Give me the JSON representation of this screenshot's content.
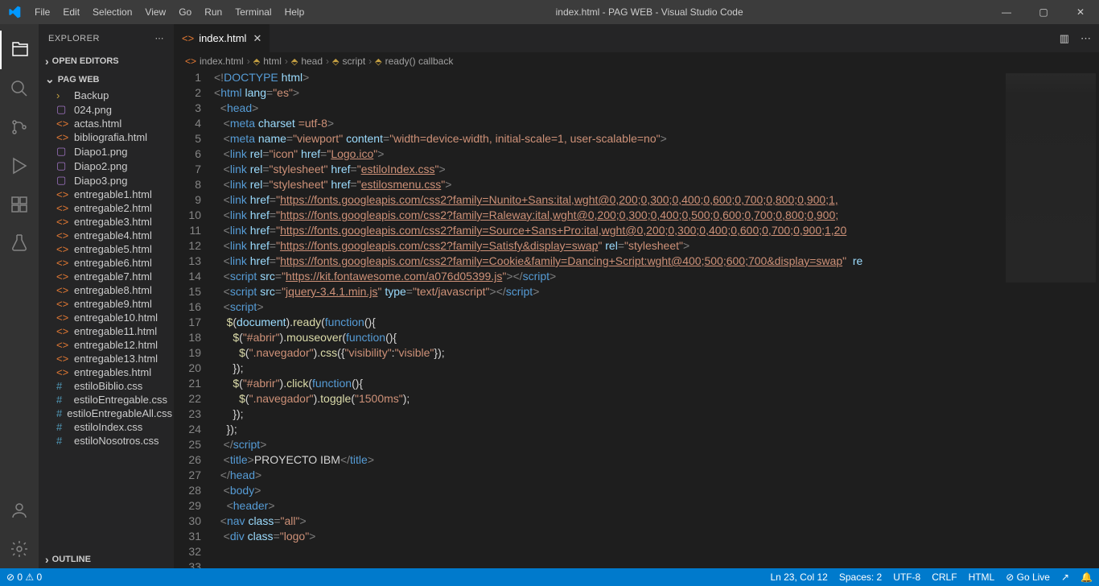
{
  "titlebar": {
    "menus": [
      "File",
      "Edit",
      "Selection",
      "View",
      "Go",
      "Run",
      "Terminal",
      "Help"
    ],
    "title": "index.html - PAG WEB - Visual Studio Code"
  },
  "activitybar": {
    "icons": [
      "files-icon",
      "search-icon",
      "source-control-icon",
      "run-debug-icon",
      "extensions-icon",
      "testing-icon"
    ],
    "bottom": [
      "account-icon",
      "gear-icon"
    ]
  },
  "sidebar": {
    "title": "EXPLORER",
    "sections": {
      "open_editors": "OPEN EDITORS",
      "folder": "PAG WEB",
      "outline": "OUTLINE"
    },
    "files": [
      {
        "label": "Backup",
        "icon": "›",
        "color": "#c5a042",
        "folder": true
      },
      {
        "label": "024.png",
        "icon": "▢",
        "color": "#a074c4"
      },
      {
        "label": "actas.html",
        "icon": "<>",
        "color": "#e37933"
      },
      {
        "label": "bibliografia.html",
        "icon": "<>",
        "color": "#e37933"
      },
      {
        "label": "Diapo1.png",
        "icon": "▢",
        "color": "#a074c4"
      },
      {
        "label": "Diapo2.png",
        "icon": "▢",
        "color": "#a074c4"
      },
      {
        "label": "Diapo3.png",
        "icon": "▢",
        "color": "#a074c4"
      },
      {
        "label": "entregable1.html",
        "icon": "<>",
        "color": "#e37933"
      },
      {
        "label": "entregable2.html",
        "icon": "<>",
        "color": "#e37933"
      },
      {
        "label": "entregable3.html",
        "icon": "<>",
        "color": "#e37933"
      },
      {
        "label": "entregable4.html",
        "icon": "<>",
        "color": "#e37933"
      },
      {
        "label": "entregable5.html",
        "icon": "<>",
        "color": "#e37933"
      },
      {
        "label": "entregable6.html",
        "icon": "<>",
        "color": "#e37933"
      },
      {
        "label": "entregable7.html",
        "icon": "<>",
        "color": "#e37933"
      },
      {
        "label": "entregable8.html",
        "icon": "<>",
        "color": "#e37933"
      },
      {
        "label": "entregable9.html",
        "icon": "<>",
        "color": "#e37933"
      },
      {
        "label": "entregable10.html",
        "icon": "<>",
        "color": "#e37933"
      },
      {
        "label": "entregable11.html",
        "icon": "<>",
        "color": "#e37933"
      },
      {
        "label": "entregable12.html",
        "icon": "<>",
        "color": "#e37933"
      },
      {
        "label": "entregable13.html",
        "icon": "<>",
        "color": "#e37933"
      },
      {
        "label": "entregables.html",
        "icon": "<>",
        "color": "#e37933"
      },
      {
        "label": "estiloBiblio.css",
        "icon": "#",
        "color": "#519aba"
      },
      {
        "label": "estiloEntregable.css",
        "icon": "#",
        "color": "#519aba"
      },
      {
        "label": "estiloEntregableAll.css",
        "icon": "#",
        "color": "#519aba"
      },
      {
        "label": "estiloIndex.css",
        "icon": "#",
        "color": "#519aba"
      },
      {
        "label": "estiloNosotros.css",
        "icon": "#",
        "color": "#519aba"
      }
    ]
  },
  "tabs": {
    "tab0": "index.html"
  },
  "breadcrumb": {
    "items": [
      "index.html",
      "html",
      "head",
      "script",
      "ready() callback"
    ]
  },
  "editor_lines": [
    1,
    2,
    3,
    4,
    5,
    6,
    7,
    8,
    9,
    10,
    11,
    12,
    13,
    14,
    15,
    16,
    17,
    18,
    19,
    20,
    21,
    22,
    23,
    24,
    25,
    26,
    27,
    28,
    29,
    30,
    31,
    32,
    33
  ],
  "code_strings": {
    "logo_ico": "Logo.ico",
    "estilo_index": "estiloIndex.css",
    "estilos_menu": "estilosmenu.css",
    "jquery": "jquery-3.4.1.min.js",
    "fontawesome": "https://kit.fontawesome.com/a076d05399.js",
    "nunito": "https://fonts.googleapis.com/css2?family=Nunito+Sans:ital,wght@0,200;0,300;0,400;0,600;0,700;0,800;0,900;1,",
    "raleway": "https://fonts.googleapis.com/css2?family=Raleway:ital,wght@0,200;0,300;0,400;0,500;0,600;0,700;0,800;0,900;",
    "source_sans": "https://fonts.googleapis.com/css2?family=Source+Sans+Pro:ital,wght@0,200;0,300;0,400;0,600;0,700;0,900;1,20",
    "satisfy": "https://fonts.googleapis.com/css2?family=Satisfy&display=swap",
    "cookie": "https://fonts.googleapis.com/css2?family=Cookie&family=Dancing+Script:wght@400;500;600;700&display=swap",
    "project_title": "PROYECTO IBM"
  },
  "statusbar": {
    "left": [
      "⊘ 0 ⚠ 0"
    ],
    "right": [
      "Ln 23, Col 12",
      "Spaces: 2",
      "UTF-8",
      "CRLF",
      "HTML",
      "⊘ Go Live",
      "↗",
      "🔔"
    ]
  }
}
